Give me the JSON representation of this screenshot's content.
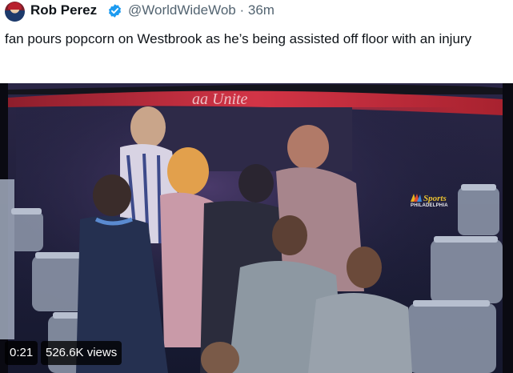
{
  "tweet": {
    "author_name": "Rob Perez",
    "handle": "@WorldWideWob",
    "separator": "·",
    "time_ago": "36m",
    "text": "fan pours popcorn on Westbrook as he’s being assisted off floor with an injury"
  },
  "video": {
    "elapsed": "0:21",
    "views": "526.6K views",
    "broadcaster_logo": "Sports",
    "broadcaster_sub": "PHILADELPHIA"
  },
  "colors": {
    "verified": "#1d9bf0",
    "text": "#0f1419",
    "muted": "#536471",
    "tunnel_red": "#c8283a",
    "stands_blue": "#1a1e3a"
  }
}
